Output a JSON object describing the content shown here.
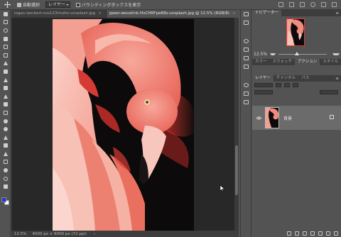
{
  "options_bar": {
    "auto_select_label": "自動選択",
    "auto_select_checked": true,
    "auto_select_target": "レイヤー",
    "transform_controls_label": "バウンディングボックスを表示",
    "transform_controls_checked": false
  },
  "document_tabs": [
    {
      "label": "logan-lambert-nzz123tmzhs-unsplash.jpg",
      "close": "×",
      "active": false
    },
    {
      "label": "gwen-weustink-HvCHRFpeK8s-unsplash.jpg @ 12.5% (RGB/8)",
      "close": "×",
      "active": true
    },
    {
      "label": "caleb-ekeroth-",
      "close": "",
      "active": false
    }
  ],
  "status_bar": {
    "zoom": "12.5%",
    "doc_info": "4000 px × 6000 px (72 ppi)",
    "arrow": "›"
  },
  "navigator": {
    "title": "ナビゲーター",
    "zoom": "12.5%"
  },
  "adjust_tabs": [
    "カラー",
    "スウォッチ",
    "アクション",
    "スタイル"
  ],
  "layers_tabs": [
    "レイヤー",
    "チャンネル",
    "パス"
  ],
  "layer": {
    "name": "背景"
  },
  "menu_glyph": "≡",
  "colors": {
    "foreground": "#1a3bd6",
    "background": "#ffffff",
    "flamingo_pink": "#f38a7c",
    "flamingo_red": "#d63a34"
  },
  "icons": [
    "move-icon",
    "marquee-icon",
    "lasso-icon",
    "crop-icon",
    "eyedropper-icon",
    "brush-icon",
    "stamp-icon",
    "eraser-icon",
    "gradient-icon",
    "pen-icon",
    "type-icon",
    "path-select-icon",
    "shape-icon",
    "hand-icon",
    "zoom-icon",
    "eye-icon",
    "lock-icon"
  ]
}
